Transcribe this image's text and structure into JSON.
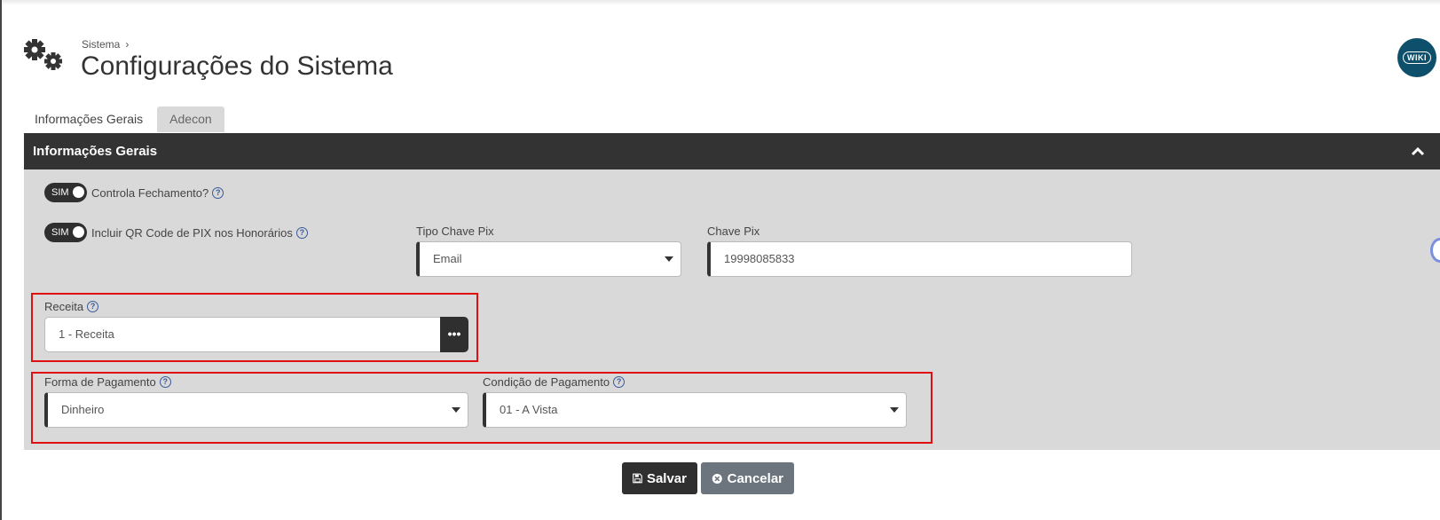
{
  "breadcrumb": {
    "parent": "Sistema"
  },
  "page_title": "Configurações do Sistema",
  "wiki_badge": "WIKI",
  "tabs": [
    {
      "label": "Informações Gerais",
      "active": true
    },
    {
      "label": "Adecon",
      "active": false
    }
  ],
  "section": {
    "title": "Informações Gerais"
  },
  "toggles": {
    "controla_fechamento": {
      "state": "SIM",
      "label": "Controla Fechamento?"
    },
    "qr_code_pix": {
      "state": "SIM",
      "label": "Incluir QR Code de PIX nos Honorários"
    }
  },
  "fields": {
    "tipo_chave_pix": {
      "label": "Tipo Chave Pix",
      "value": "Email"
    },
    "chave_pix": {
      "label": "Chave Pix",
      "value": "19998085833"
    },
    "receita": {
      "label": "Receita",
      "value": "1 - Receita"
    },
    "forma_pagamento": {
      "label": "Forma de Pagamento",
      "value": "Dinheiro"
    },
    "condicao_pagamento": {
      "label": "Condição de Pagamento",
      "value": "01 - A Vista"
    }
  },
  "buttons": {
    "save": "Salvar",
    "cancel": "Cancelar"
  },
  "colors": {
    "header_bg": "#333333",
    "panel_bg": "#d9d9d9",
    "highlight": "#e01010",
    "cancel_bg": "#6c757d"
  }
}
